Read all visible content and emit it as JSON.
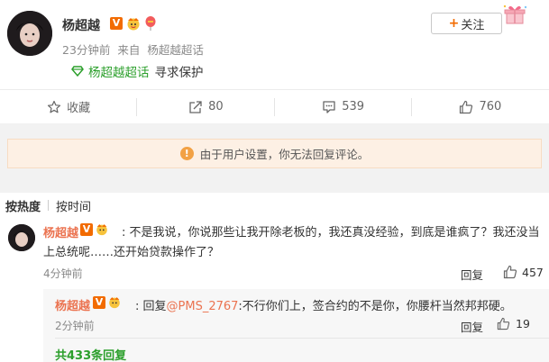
{
  "post": {
    "author": "杨超越",
    "time": "23分钟前",
    "source_prefix": "来自",
    "source": "杨超越超话",
    "supertopic_name": "杨超越超话",
    "supertopic_desc": "寻求保护",
    "follow_label": "关注"
  },
  "actions": {
    "favorite": "收藏",
    "repost": "80",
    "comment": "539",
    "like": "760"
  },
  "notice": "由于用户设置，你无法回复评论。",
  "sort": {
    "hot": "按热度",
    "time": "按时间"
  },
  "comment": {
    "author": "杨超越",
    "text": ": 不是我说，你说那些让我开除老板的，我还真没经验，到底是谁疯了？我还没当上总统呢……还开始贷款操作了？",
    "time": "4分钟前",
    "reply_label": "回复",
    "likes": "457"
  },
  "sub_reply": {
    "author": "杨超越",
    "prefix": ": 回复",
    "mention": "@PMS_2767",
    "text": ":不行你们上，签合约的不是你，你腰杆当然邦邦硬。",
    "time": "2分钟前",
    "reply_label": "回复",
    "likes": "19",
    "more": "共433条回复"
  },
  "colors": {
    "brand_orange": "#f26b00",
    "name_color": "#eb7350",
    "supertopic_green": "#2b9f2b",
    "notice_bg": "#fdf0e4"
  },
  "icons": [
    "star-icon",
    "repost-icon",
    "comment-icon",
    "thumb-up-icon",
    "warning-icon",
    "supertopic-diamond-icon",
    "verified-v-icon",
    "crown-emoji-icon",
    "balloon-icon",
    "gift-box-icon"
  ]
}
